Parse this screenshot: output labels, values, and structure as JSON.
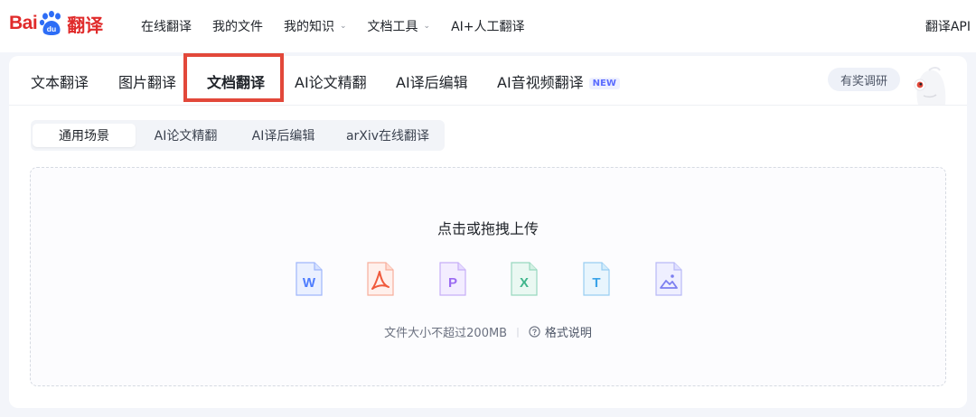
{
  "brand": {
    "logo_part1": "Bai",
    "logo_part2": "翻译",
    "logo_name": "Baidu 翻译"
  },
  "topnav": {
    "items": [
      {
        "label": "在线翻译",
        "dropdown": false
      },
      {
        "label": "我的文件",
        "dropdown": false
      },
      {
        "label": "我的知识",
        "dropdown": true
      },
      {
        "label": "文档工具",
        "dropdown": true
      },
      {
        "label": "AI+人工翻译",
        "dropdown": false
      }
    ],
    "api_label": "翻译API"
  },
  "main_tabs": {
    "items": [
      {
        "label": "文本翻译"
      },
      {
        "label": "图片翻译"
      },
      {
        "label": "文档翻译",
        "active": true,
        "highlighted": true
      },
      {
        "label": "AI论文精翻"
      },
      {
        "label": "AI译后编辑"
      },
      {
        "label": "AI音视频翻译",
        "badge": "NEW"
      }
    ],
    "survey_label": "有奖调研"
  },
  "sub_tabs": {
    "items": [
      {
        "label": "通用场景",
        "active": true
      },
      {
        "label": "AI论文精翻"
      },
      {
        "label": "AI译后编辑"
      },
      {
        "label": "arXiv在线翻译"
      }
    ]
  },
  "upload": {
    "title": "点击或拖拽上传",
    "file_types": [
      {
        "name": "word-file-icon",
        "letter": "W",
        "color": "#4d7cfe"
      },
      {
        "name": "pdf-file-icon",
        "letter": "",
        "color": "#f05a3c"
      },
      {
        "name": "ppt-file-icon",
        "letter": "P",
        "color": "#9b6bf2"
      },
      {
        "name": "excel-file-icon",
        "letter": "X",
        "color": "#3fb58b"
      },
      {
        "name": "txt-file-icon",
        "letter": "T",
        "color": "#3aa3e8"
      },
      {
        "name": "image-file-icon",
        "letter": "",
        "color": "#7c7ff0"
      }
    ],
    "size_note": "文件大小不超过200MB",
    "format_help": "格式说明"
  },
  "colors": {
    "brand_red": "#e02b2b",
    "highlight_red": "#e2483a",
    "accent_blue": "#4e6ef2"
  }
}
